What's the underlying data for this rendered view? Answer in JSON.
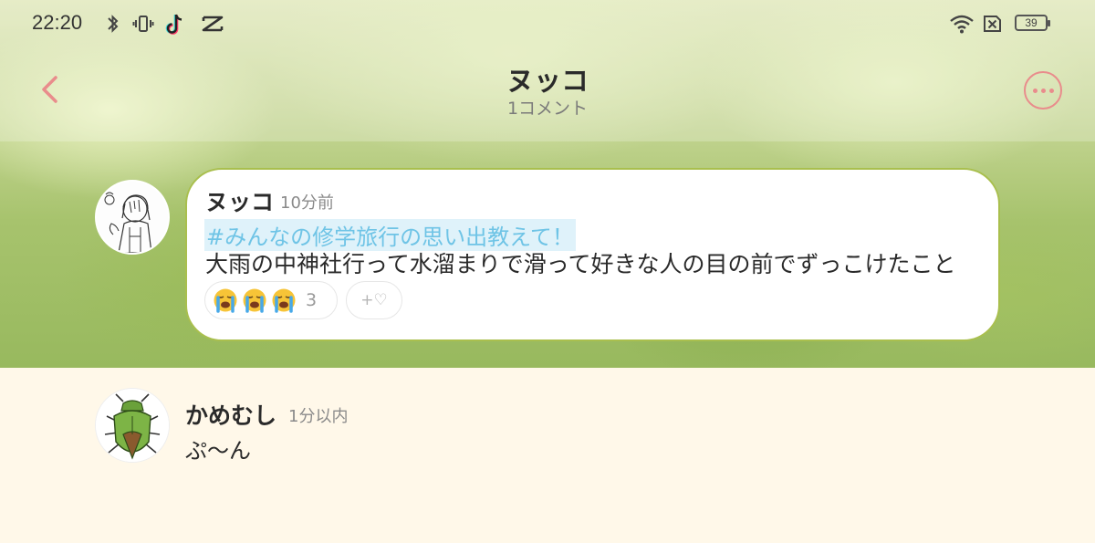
{
  "status_bar": {
    "time": "22:20",
    "battery": "39",
    "icons": [
      "bluetooth-icon",
      "vibrate-icon",
      "tiktok-icon",
      "capcut-icon",
      "wifi-icon",
      "no-sim-icon",
      "battery-icon"
    ]
  },
  "header": {
    "title": "ヌッコ",
    "subtitle": "1コメント",
    "accent_color": "#e98c8c"
  },
  "post": {
    "author": "ヌッコ",
    "time": "10分前",
    "hashtag": "#みんなの修学旅行の思い出教えて！",
    "body": "大雨の中神社行って水溜まりで滑って好きな人の目の前でずっこけたこと",
    "reaction_emoji": "loudly-crying-face",
    "reaction_count": "3",
    "add_reaction_label": "+♡"
  },
  "comments": [
    {
      "author": "かめむし",
      "time": "1分以内",
      "body": "ぷ〜ん"
    }
  ]
}
